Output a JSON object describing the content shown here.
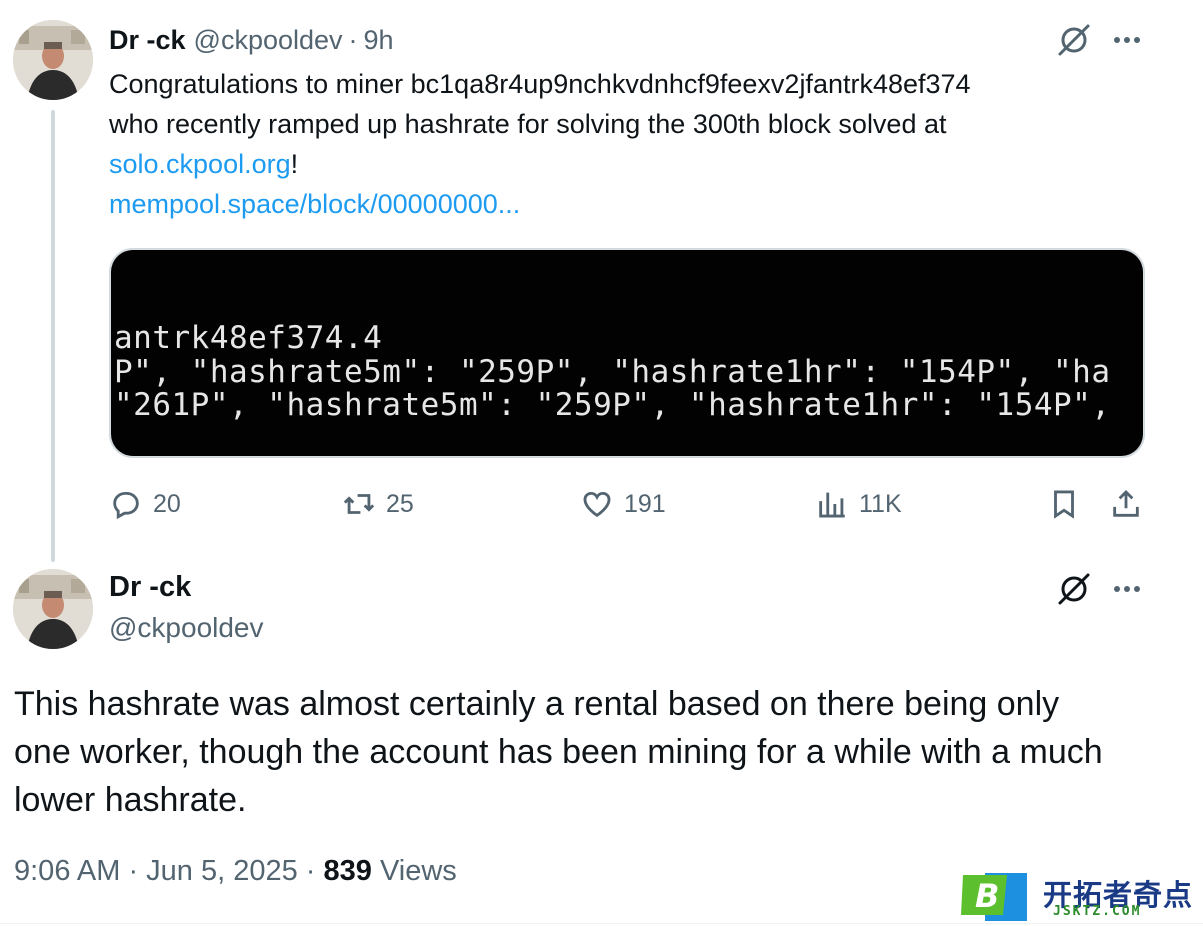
{
  "tweet1": {
    "author_name": "Dr -ck",
    "handle": "@ckpooldev",
    "separator": "·",
    "time": "9h",
    "text_line1": "Congratulations to miner bc1qa8r4up9nchkvdnhcf9feexv2jfantrk48ef374",
    "text_line2": "who recently ramped up hashrate for solving the 300th block solved at",
    "link1": "solo.ckpool.org",
    "link1_suffix": "!",
    "link2": "mempool.space/block/00000000...",
    "media_lines": [
      "antrk48ef374.4",
      "P\", \"hashrate5m\": \"259P\", \"hashrate1hr\": \"154P\", \"ha",
      "\"261P\", \"hashrate5m\": \"259P\", \"hashrate1hr\": \"154P\","
    ],
    "stats": {
      "replies": "20",
      "reposts": "25",
      "likes": "191",
      "views": "11K"
    }
  },
  "tweet2": {
    "author_name": "Dr -ck",
    "handle": "@ckpooldev",
    "text_line1": "This hashrate was almost certainly a rental based on there being only",
    "text_line2": "one worker, though the account has been mining for a while with a much",
    "text_line3": "lower hashrate.",
    "timestamp": "9:06 AM · Jun 5, 2025 · ",
    "view_count": "839",
    "views_label": " Views"
  },
  "watermark": {
    "logo_letter": "B",
    "cn_text": "开拓者奇点",
    "en_text": "JSKTZ.COM"
  },
  "colors": {
    "link": "#1d9bf0",
    "secondary_text": "#536471",
    "primary_text": "#0f1419",
    "terminal_bg": "#020202"
  }
}
